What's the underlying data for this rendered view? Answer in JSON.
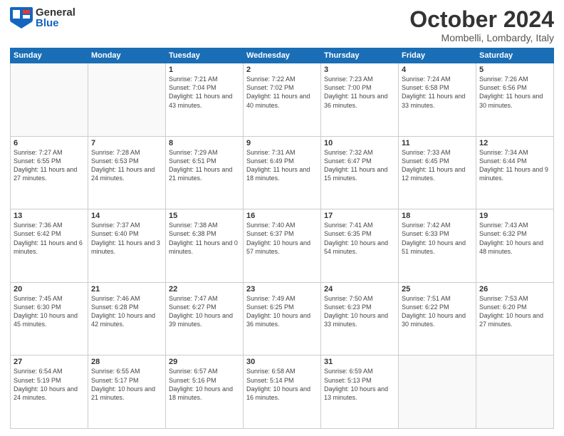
{
  "header": {
    "logo_general": "General",
    "logo_blue": "Blue",
    "month_title": "October 2024",
    "location": "Mombelli, Lombardy, Italy"
  },
  "weekdays": [
    "Sunday",
    "Monday",
    "Tuesday",
    "Wednesday",
    "Thursday",
    "Friday",
    "Saturday"
  ],
  "weeks": [
    [
      {
        "day": "",
        "info": ""
      },
      {
        "day": "",
        "info": ""
      },
      {
        "day": "1",
        "info": "Sunrise: 7:21 AM\nSunset: 7:04 PM\nDaylight: 11 hours and 43 minutes."
      },
      {
        "day": "2",
        "info": "Sunrise: 7:22 AM\nSunset: 7:02 PM\nDaylight: 11 hours and 40 minutes."
      },
      {
        "day": "3",
        "info": "Sunrise: 7:23 AM\nSunset: 7:00 PM\nDaylight: 11 hours and 36 minutes."
      },
      {
        "day": "4",
        "info": "Sunrise: 7:24 AM\nSunset: 6:58 PM\nDaylight: 11 hours and 33 minutes."
      },
      {
        "day": "5",
        "info": "Sunrise: 7:26 AM\nSunset: 6:56 PM\nDaylight: 11 hours and 30 minutes."
      }
    ],
    [
      {
        "day": "6",
        "info": "Sunrise: 7:27 AM\nSunset: 6:55 PM\nDaylight: 11 hours and 27 minutes."
      },
      {
        "day": "7",
        "info": "Sunrise: 7:28 AM\nSunset: 6:53 PM\nDaylight: 11 hours and 24 minutes."
      },
      {
        "day": "8",
        "info": "Sunrise: 7:29 AM\nSunset: 6:51 PM\nDaylight: 11 hours and 21 minutes."
      },
      {
        "day": "9",
        "info": "Sunrise: 7:31 AM\nSunset: 6:49 PM\nDaylight: 11 hours and 18 minutes."
      },
      {
        "day": "10",
        "info": "Sunrise: 7:32 AM\nSunset: 6:47 PM\nDaylight: 11 hours and 15 minutes."
      },
      {
        "day": "11",
        "info": "Sunrise: 7:33 AM\nSunset: 6:45 PM\nDaylight: 11 hours and 12 minutes."
      },
      {
        "day": "12",
        "info": "Sunrise: 7:34 AM\nSunset: 6:44 PM\nDaylight: 11 hours and 9 minutes."
      }
    ],
    [
      {
        "day": "13",
        "info": "Sunrise: 7:36 AM\nSunset: 6:42 PM\nDaylight: 11 hours and 6 minutes."
      },
      {
        "day": "14",
        "info": "Sunrise: 7:37 AM\nSunset: 6:40 PM\nDaylight: 11 hours and 3 minutes."
      },
      {
        "day": "15",
        "info": "Sunrise: 7:38 AM\nSunset: 6:38 PM\nDaylight: 11 hours and 0 minutes."
      },
      {
        "day": "16",
        "info": "Sunrise: 7:40 AM\nSunset: 6:37 PM\nDaylight: 10 hours and 57 minutes."
      },
      {
        "day": "17",
        "info": "Sunrise: 7:41 AM\nSunset: 6:35 PM\nDaylight: 10 hours and 54 minutes."
      },
      {
        "day": "18",
        "info": "Sunrise: 7:42 AM\nSunset: 6:33 PM\nDaylight: 10 hours and 51 minutes."
      },
      {
        "day": "19",
        "info": "Sunrise: 7:43 AM\nSunset: 6:32 PM\nDaylight: 10 hours and 48 minutes."
      }
    ],
    [
      {
        "day": "20",
        "info": "Sunrise: 7:45 AM\nSunset: 6:30 PM\nDaylight: 10 hours and 45 minutes."
      },
      {
        "day": "21",
        "info": "Sunrise: 7:46 AM\nSunset: 6:28 PM\nDaylight: 10 hours and 42 minutes."
      },
      {
        "day": "22",
        "info": "Sunrise: 7:47 AM\nSunset: 6:27 PM\nDaylight: 10 hours and 39 minutes."
      },
      {
        "day": "23",
        "info": "Sunrise: 7:49 AM\nSunset: 6:25 PM\nDaylight: 10 hours and 36 minutes."
      },
      {
        "day": "24",
        "info": "Sunrise: 7:50 AM\nSunset: 6:23 PM\nDaylight: 10 hours and 33 minutes."
      },
      {
        "day": "25",
        "info": "Sunrise: 7:51 AM\nSunset: 6:22 PM\nDaylight: 10 hours and 30 minutes."
      },
      {
        "day": "26",
        "info": "Sunrise: 7:53 AM\nSunset: 6:20 PM\nDaylight: 10 hours and 27 minutes."
      }
    ],
    [
      {
        "day": "27",
        "info": "Sunrise: 6:54 AM\nSunset: 5:19 PM\nDaylight: 10 hours and 24 minutes."
      },
      {
        "day": "28",
        "info": "Sunrise: 6:55 AM\nSunset: 5:17 PM\nDaylight: 10 hours and 21 minutes."
      },
      {
        "day": "29",
        "info": "Sunrise: 6:57 AM\nSunset: 5:16 PM\nDaylight: 10 hours and 18 minutes."
      },
      {
        "day": "30",
        "info": "Sunrise: 6:58 AM\nSunset: 5:14 PM\nDaylight: 10 hours and 16 minutes."
      },
      {
        "day": "31",
        "info": "Sunrise: 6:59 AM\nSunset: 5:13 PM\nDaylight: 10 hours and 13 minutes."
      },
      {
        "day": "",
        "info": ""
      },
      {
        "day": "",
        "info": ""
      }
    ]
  ]
}
